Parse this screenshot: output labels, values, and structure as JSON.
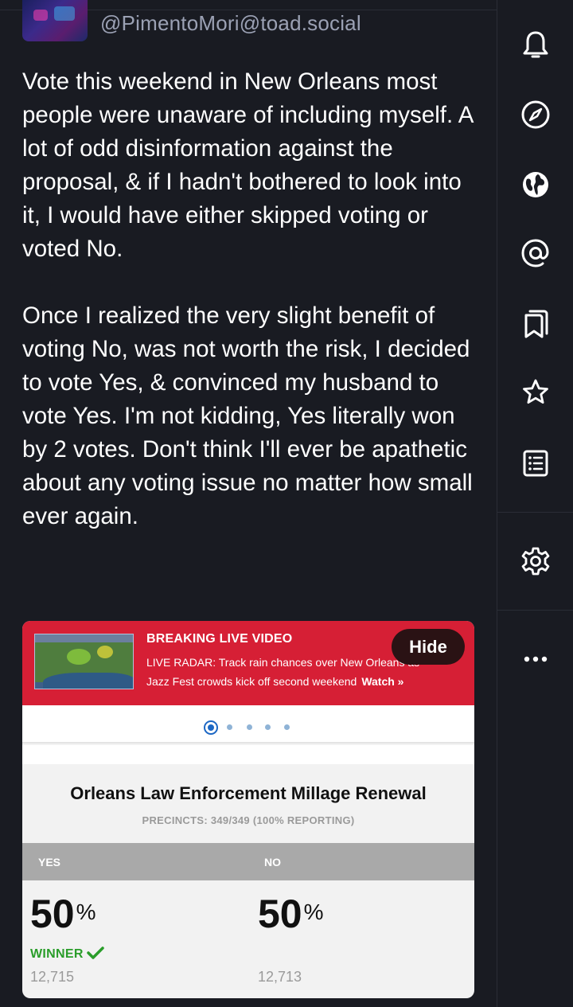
{
  "post": {
    "handle": "@PimentoMori@toad.social",
    "paragraphs": [
      "Vote this weekend in New Orleans most people were unaware of including myself. A lot of odd disinformation against the proposal, & if I hadn't bothered to look into it, I would have either skipped voting or voted No.",
      "Once I realized the very slight benefit of voting No, was not worth the risk, I decided to vote Yes, & convinced my husband to vote Yes. I'm not kidding, Yes literally won by 2 votes. Don't think I'll ever be apathetic about any voting issue no matter how small ever again."
    ]
  },
  "attachment": {
    "banner": {
      "title": "BREAKING LIVE VIDEO",
      "line1": "LIVE RADAR: Track rain chances over New Orleans as",
      "line2": "Jazz Fest crowds kick off second weekend",
      "watch": "Watch »",
      "hide": "Hide"
    },
    "race": {
      "title": "Orleans Law Enforcement Millage Renewal",
      "precincts": "PRECINCTS: 349/349 (100% REPORTING)",
      "yes_label": "YES",
      "no_label": "NO",
      "yes_pct": "50",
      "no_pct": "50",
      "pct_symbol": "%",
      "winner": "WINNER",
      "yes_votes": "12,715",
      "no_votes": "12,713"
    },
    "carousel_dots": 5,
    "carousel_active": 0
  },
  "rail": {
    "icons": [
      "bell-icon",
      "compass-icon",
      "globe-icon",
      "at-icon",
      "bookmarks-icon",
      "star-icon",
      "list-icon",
      "gear-icon",
      "more-icon"
    ]
  },
  "colors": {
    "background": "#191b22",
    "text": "#ffffff",
    "muted": "#9ba1b4",
    "banner_red": "#d61f35",
    "winner_green": "#2a9d2a"
  }
}
